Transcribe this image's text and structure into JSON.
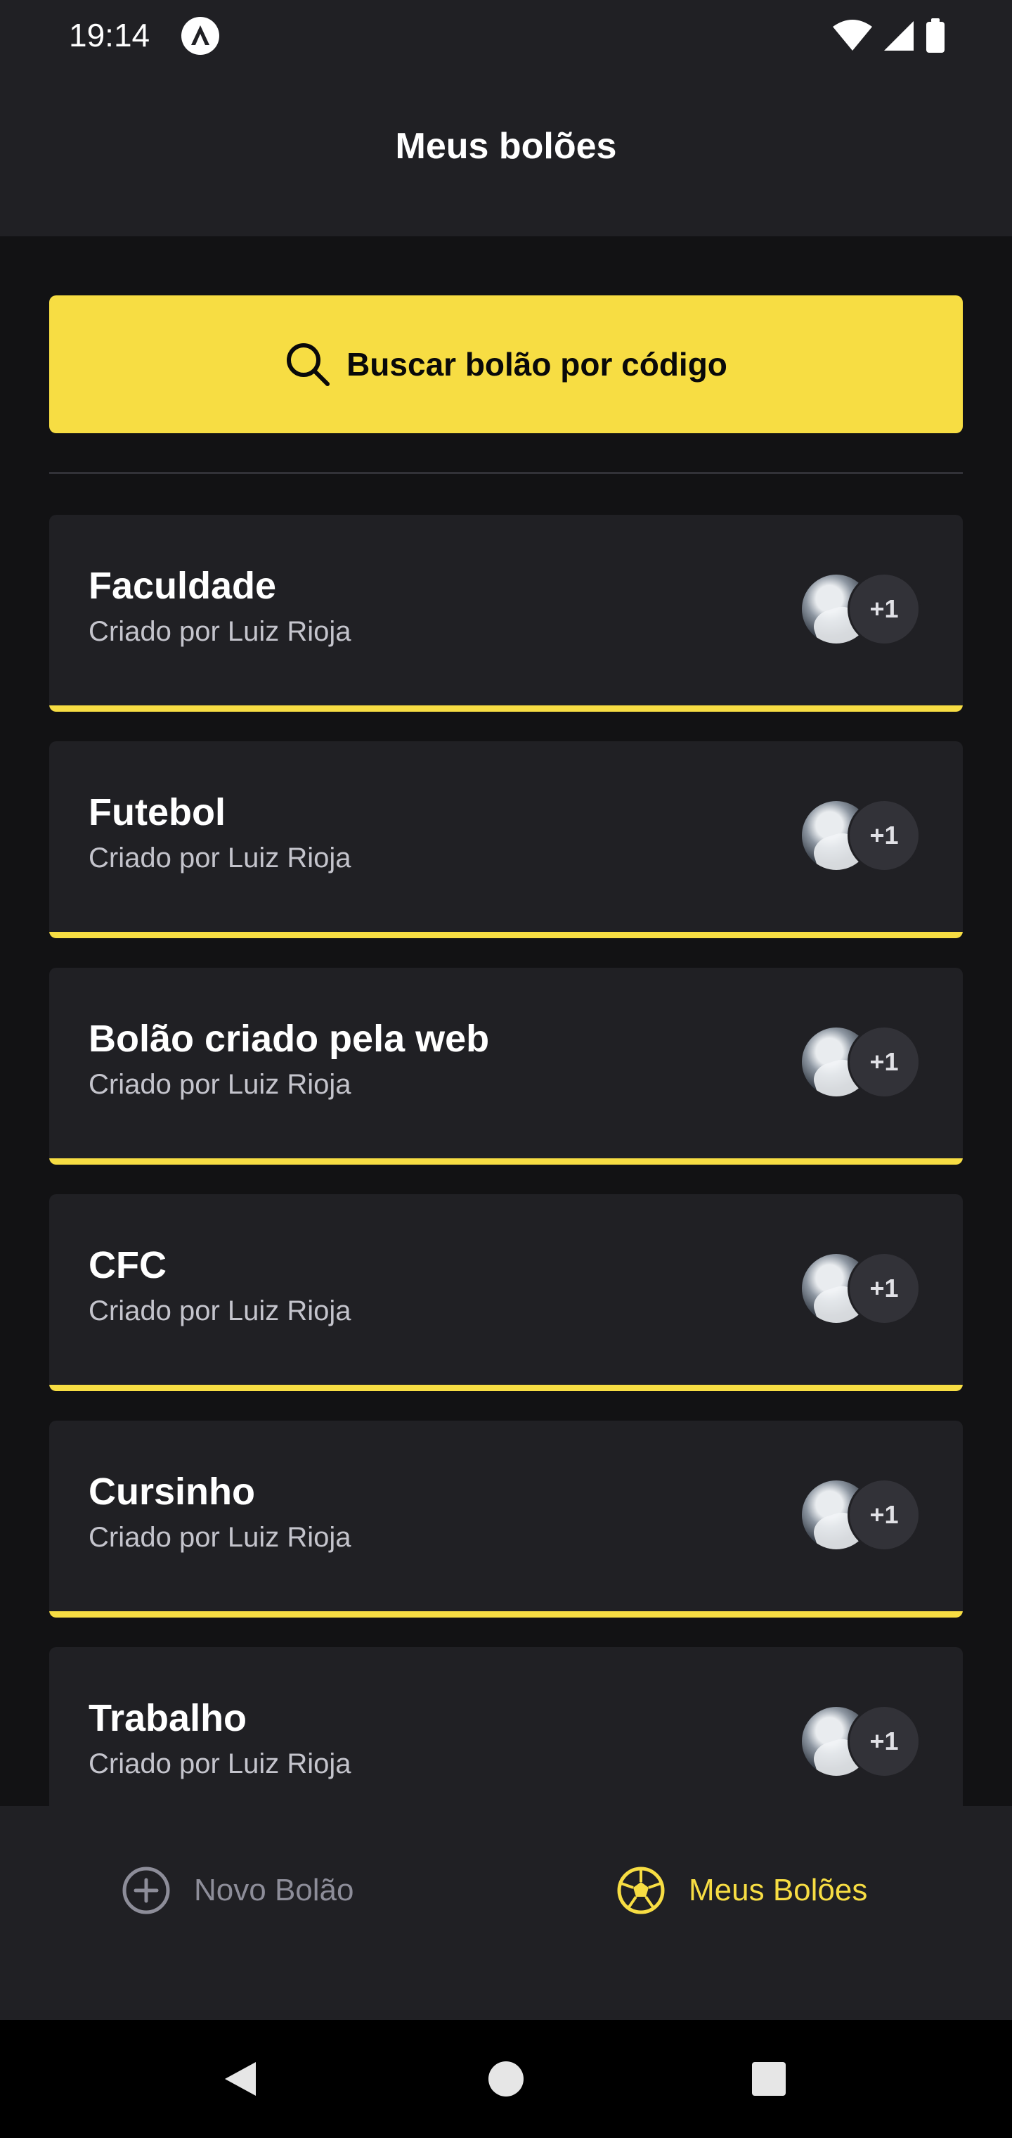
{
  "status_bar": {
    "time": "19:14"
  },
  "header": {
    "title": "Meus bolões"
  },
  "search": {
    "label": "Buscar bolão por código"
  },
  "pools": [
    {
      "title": "Faculdade",
      "owner": "Criado por Luiz Rioja",
      "participants_extra": "+1"
    },
    {
      "title": "Futebol",
      "owner": "Criado por Luiz Rioja",
      "participants_extra": "+1"
    },
    {
      "title": "Bolão criado pela web",
      "owner": "Criado por Luiz Rioja",
      "participants_extra": "+1"
    },
    {
      "title": "CFC",
      "owner": "Criado por Luiz Rioja",
      "participants_extra": "+1"
    },
    {
      "title": "Cursinho",
      "owner": "Criado por Luiz Rioja",
      "participants_extra": "+1"
    },
    {
      "title": "Trabalho",
      "owner": "Criado por Luiz Rioja",
      "participants_extra": "+1"
    }
  ],
  "tabs": [
    {
      "label": "Novo Bolão",
      "icon": "plus-circle-icon",
      "active": false
    },
    {
      "label": "Meus Bolões",
      "icon": "soccer-ball-icon",
      "active": true
    }
  ],
  "colors": {
    "accent": "#F7DD43",
    "background": "#121214",
    "surface": "#202024",
    "muted": "#8D8D99"
  }
}
